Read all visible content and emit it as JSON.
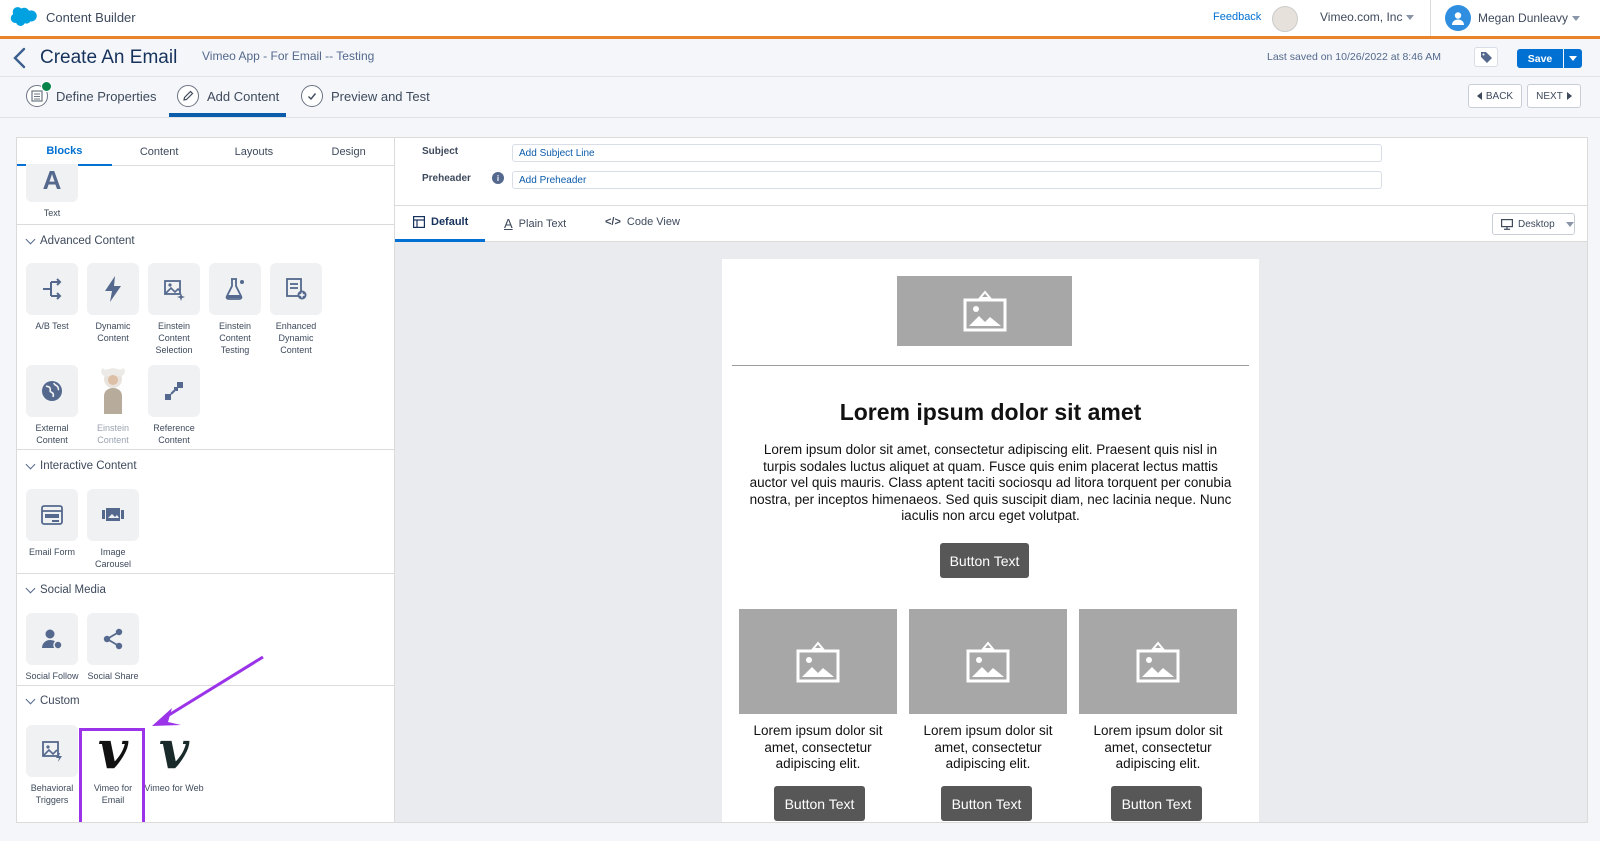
{
  "topbar": {
    "app_title": "Content Builder",
    "feedback": "Feedback",
    "org": "Vimeo.com, Inc",
    "user": "Megan Dunleavy"
  },
  "header": {
    "title": "Create An Email",
    "subtitle": "Vimeo App - For Email -- Testing",
    "last_saved": "Last saved on 10/26/2022 at 8:46 AM",
    "save_label": "Save"
  },
  "steps": [
    {
      "label": "Define Properties"
    },
    {
      "label": "Add Content"
    },
    {
      "label": "Preview and Test"
    }
  ],
  "nav": {
    "back": "BACK",
    "next": "NEXT"
  },
  "left_tabs": [
    "Blocks",
    "Content",
    "Layouts",
    "Design"
  ],
  "basic_blocks": [
    {
      "label": "Text"
    }
  ],
  "sections": {
    "advanced": {
      "title": "Advanced Content",
      "items": [
        "A/B Test",
        "Dynamic Content",
        "Einstein Content Selection",
        "Einstein Content Testing",
        "Enhanced Dynamic Content",
        "External Content",
        "Einstein Content",
        "Reference Content"
      ]
    },
    "interactive": {
      "title": "Interactive Content",
      "items": [
        "Email Form",
        "Image Carousel"
      ]
    },
    "social": {
      "title": "Social Media",
      "items": [
        "Social Follow",
        "Social Share"
      ]
    },
    "custom": {
      "title": "Custom",
      "items": [
        "Behavioral Triggers",
        "Vimeo for Email",
        "Vimeo for Web"
      ]
    }
  },
  "fields": {
    "subject_label": "Subject",
    "subject_placeholder": "Add Subject Line",
    "preheader_label": "Preheader",
    "preheader_placeholder": "Add Preheader"
  },
  "view_tabs": [
    "Default",
    "Plain Text",
    "Code View"
  ],
  "device": "Desktop",
  "email": {
    "heading": "Lorem ipsum dolor sit amet",
    "body": "Lorem ipsum dolor sit amet, consectetur adipiscing elit. Praesent quis nisl in turpis sodales luctus aliquet at quam. Fusce quis enim placerat lectus mattis auctor vel quis mauris. Class aptent taciti sociosqu ad litora torquent per conubia nostra, per inceptos himenaeos. Sed quis suscipit diam, nec lacinia neque. Nunc iaculis non arcu eget volutpat.",
    "button": "Button Text",
    "columns": [
      {
        "text": "Lorem ipsum dolor sit amet, consectetur adipiscing elit.",
        "button": "Button Text"
      },
      {
        "text": "Lorem ipsum dolor sit amet, consectetur adipiscing elit.",
        "button": "Button Text"
      },
      {
        "text": "Lorem ipsum dolor sit amet, consectetur adipiscing elit.",
        "button": "Button Text"
      }
    ]
  },
  "colors": {
    "brand_blue": "#0070d2",
    "highlight_purple": "#9b34e8",
    "orange_bar": "#e8832a"
  }
}
